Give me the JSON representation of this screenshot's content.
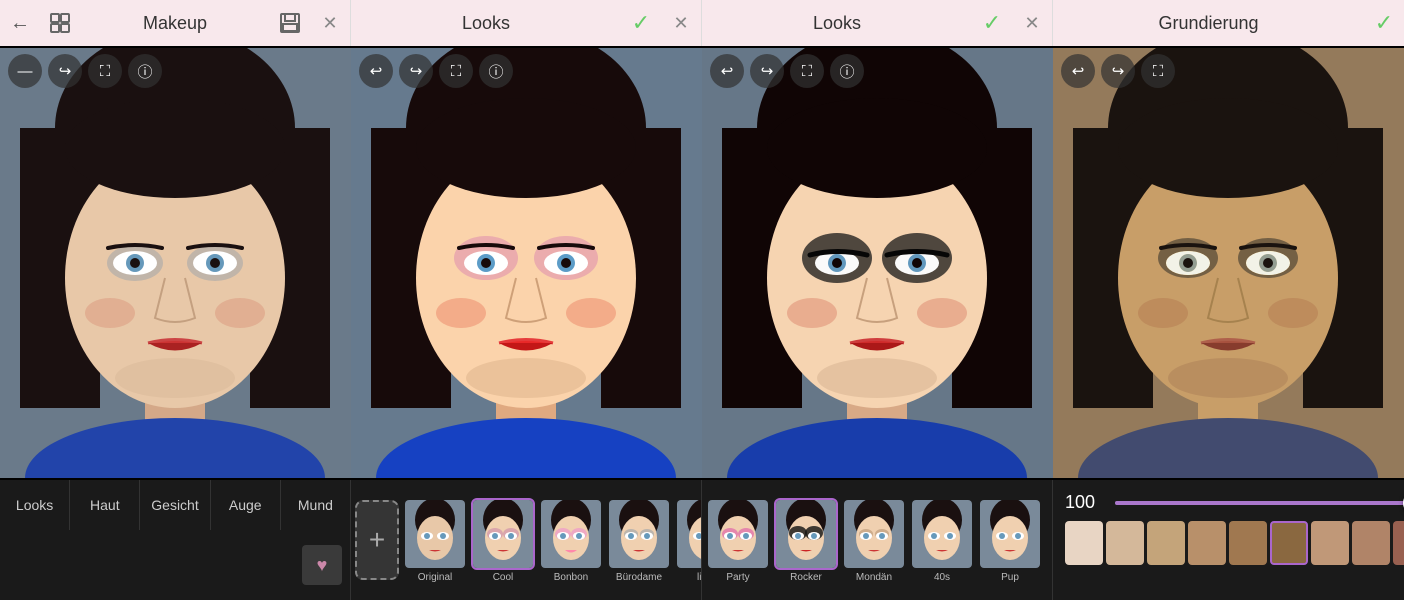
{
  "panels": [
    {
      "id": "panel-1",
      "title": "Makeup",
      "showBack": false,
      "showSave": true,
      "showClose": true,
      "showCheck": false,
      "overlayIcons": [
        "minus",
        "redo",
        "crop",
        "info"
      ]
    },
    {
      "id": "panel-2",
      "title": "Looks",
      "showBack": true,
      "showCheck": true,
      "showClose": true,
      "overlayIcons": [
        "back",
        "forward",
        "crop",
        "info"
      ]
    },
    {
      "id": "panel-3",
      "title": "Looks",
      "showBack": true,
      "showCheck": true,
      "showClose": true,
      "overlayIcons": [
        "back",
        "forward",
        "crop",
        "info"
      ]
    },
    {
      "id": "panel-4",
      "title": "Grundierung",
      "showCheck": true,
      "showClose": false,
      "overlayIcons": [
        "back",
        "forward",
        "crop"
      ]
    }
  ],
  "tabs": [
    {
      "id": "looks",
      "label": "Looks",
      "active": false
    },
    {
      "id": "haut",
      "label": "Haut",
      "active": false
    },
    {
      "id": "gesicht",
      "label": "Gesicht",
      "active": false
    },
    {
      "id": "auge",
      "label": "Auge",
      "active": false
    },
    {
      "id": "mund",
      "label": "Mund",
      "active": false
    }
  ],
  "looks": [
    {
      "id": "original",
      "label": "Original",
      "selected": false
    },
    {
      "id": "cool",
      "label": "Cool",
      "selected": true
    },
    {
      "id": "bonbon",
      "label": "Bonbon",
      "selected": false
    },
    {
      "id": "burodame",
      "label": "Bürodame",
      "selected": false
    },
    {
      "id": "lisch",
      "label": "lisch",
      "selected": false
    },
    {
      "id": "party",
      "label": "Party",
      "selected": false
    },
    {
      "id": "rocker",
      "label": "Rocker",
      "selected": true
    },
    {
      "id": "mondan",
      "label": "Mondän",
      "selected": false
    },
    {
      "id": "40s",
      "label": "40s",
      "selected": false
    },
    {
      "id": "pup",
      "label": "Pup",
      "selected": false
    }
  ],
  "slider": {
    "label": "100",
    "value": 100,
    "fillPercent": 95
  },
  "swatches": [
    {
      "color": "#e8d0c0",
      "selected": false
    },
    {
      "color": "#d4b89a",
      "selected": false
    },
    {
      "color": "#c4a07a",
      "selected": false
    },
    {
      "color": "#b4906a",
      "selected": false
    },
    {
      "color": "#a07850",
      "selected": false
    },
    {
      "color": "#8a6040",
      "selected": true
    },
    {
      "color": "#c09070",
      "selected": false
    },
    {
      "color": "#b08060",
      "selected": false
    },
    {
      "color": "#a07050",
      "selected": false
    }
  ],
  "icons": {
    "back_arrow": "←",
    "forward_arrow": "→",
    "undo": "↩",
    "redo": "↪",
    "check": "✓",
    "close": "✕",
    "info": "ⓘ",
    "crop": "⛶",
    "minus": "—",
    "heart": "♥",
    "plus": "+"
  }
}
